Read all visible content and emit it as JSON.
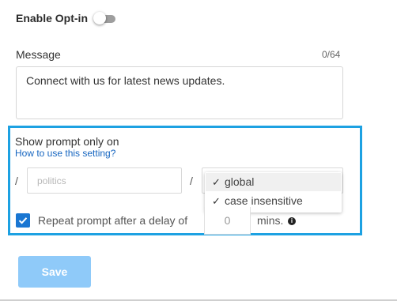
{
  "optin": {
    "label": "Enable Opt-in",
    "enabled": false
  },
  "message": {
    "label": "Message",
    "counter": "0/64",
    "value": "Connect with us for latest news updates."
  },
  "prompt_setting": {
    "title": "Show prompt only on",
    "help_link": "How to use this setting?",
    "separator": "/",
    "path_placeholder": "politics",
    "flags_options": [
      {
        "label": "global",
        "checked": true
      },
      {
        "label": "case insensitive",
        "checked": true
      }
    ],
    "check_glyph": "✓"
  },
  "repeat": {
    "checked": true,
    "label": "Repeat prompt after a delay of",
    "delay_value": "0",
    "unit_label": "mins.",
    "info_glyph": "i"
  },
  "save_label": "Save",
  "colors": {
    "accent": "#1da1e2",
    "checkbox": "#1976d2",
    "save_disabled": "#8fcaf9",
    "link": "#1565c0"
  }
}
